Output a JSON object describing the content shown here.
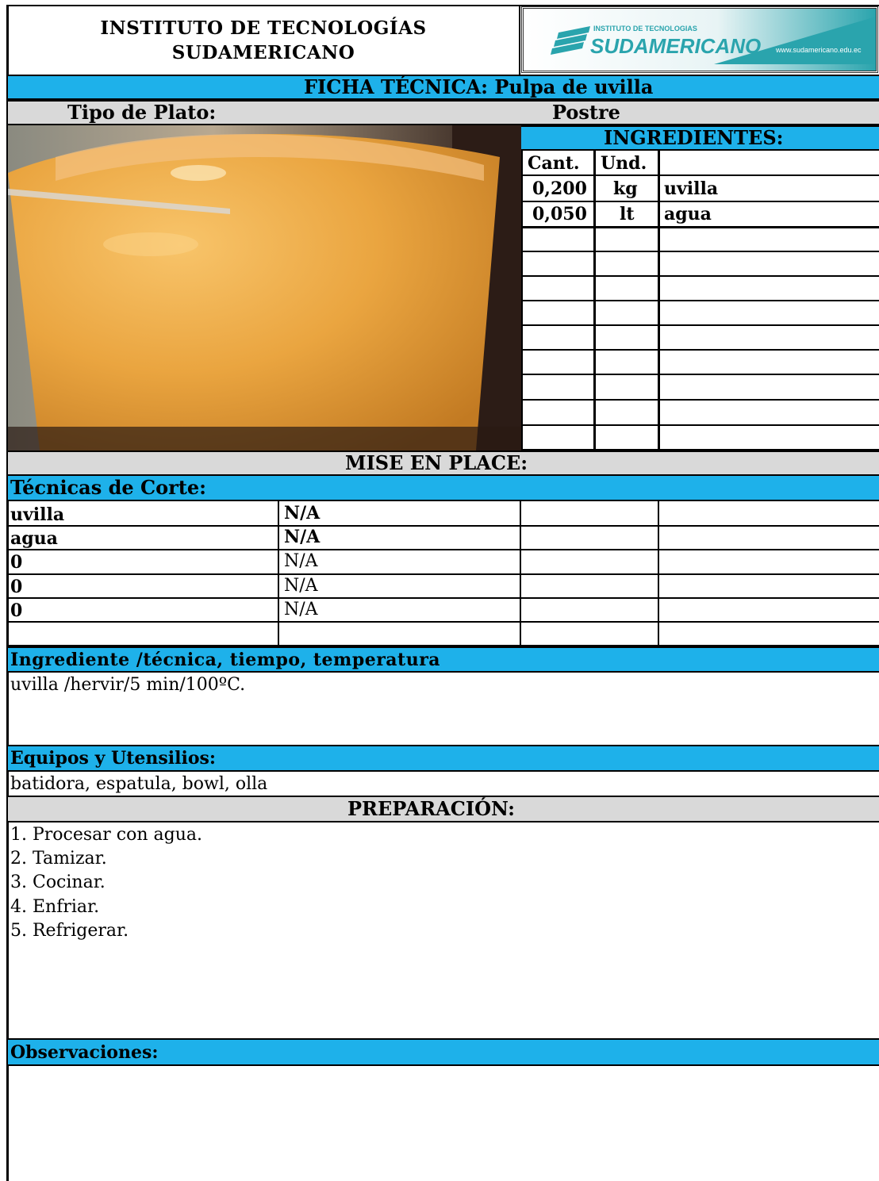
{
  "header": {
    "institute_line1": "INSTITUTO DE TECNOLOGÍAS",
    "institute_line2": "SUDAMERICANO",
    "logo_small": "INSTITUTO DE TECNOLOGIAS",
    "logo_big": "SUDAMERICANO",
    "logo_url": "www.sudamericano.edu.ec"
  },
  "ficha": {
    "label": "FICHA TÉCNICA:",
    "name": "Pulpa de uvilla"
  },
  "plato": {
    "label": "Tipo de Plato:",
    "value": "Postre"
  },
  "ingredients": {
    "title": "INGREDIENTES:",
    "col_cant": "Cant.",
    "col_und": "Und.",
    "rows": [
      {
        "cant": "0,200",
        "und": "kg",
        "name": "uvilla"
      },
      {
        "cant": "0,050",
        "und": "lt",
        "name": "agua"
      }
    ]
  },
  "mise": {
    "title": "MISE EN PLACE:",
    "tecnicas_label": "Técnicas de Corte:",
    "rows": [
      {
        "ing": "uvilla",
        "tec": "N/A"
      },
      {
        "ing": "agua",
        "tec": "N/A"
      },
      {
        "ing": "0",
        "tec": "N/A"
      },
      {
        "ing": "0",
        "tec": "N/A"
      },
      {
        "ing": "0",
        "tec": "N/A"
      }
    ]
  },
  "tecnica": {
    "label": "Ingrediente /técnica, tiempo, temperatura",
    "value": "uvilla /hervir/5 min/100ºC."
  },
  "equipos": {
    "label": "Equipos y Utensilios:",
    "value": "batidora, espatula, bowl, olla"
  },
  "preparacion": {
    "title": "PREPARACIÓN:",
    "steps": [
      "1. Procesar con agua.",
      "2. Tamizar.",
      "3. Cocinar.",
      "4. Enfriar.",
      "5. Refrigerar."
    ]
  },
  "observaciones": {
    "label": "Observaciones:"
  }
}
